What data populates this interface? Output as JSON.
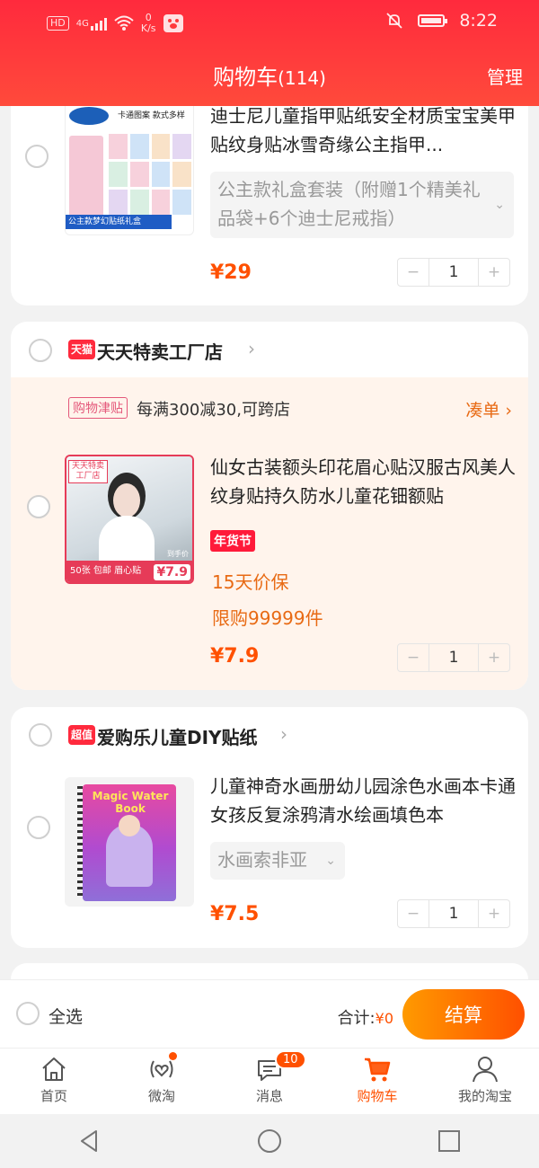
{
  "status_bar": {
    "hd_label": "HD",
    "network": "4G",
    "speed_value": "0",
    "speed_unit": "K/s",
    "time": "8:22"
  },
  "header": {
    "title": "购物车",
    "count": "(114)",
    "manage_label": "管理"
  },
  "items": [
    {
      "title": "迪士尼儿童指甲贴纸安全材质宝宝美甲贴纹身贴冰雪奇缘公主指甲...",
      "sku": "公主款礼盒套装（附赠1个精美礼品袋+6个迪士尼戒指）",
      "price": "¥29",
      "qty": "1",
      "image_caption": "公主款梦幻贴纸礼盒",
      "image_top_text": "卡通图案 款式多样"
    }
  ],
  "shop2": {
    "badge": "天猫",
    "name": "天天特卖工厂店",
    "promo_tag": "购物津贴",
    "promo_text": "每满300减30,可跨店",
    "promo_link": "凑单",
    "item": {
      "title": "仙女古装额头印花眉心贴汉服古风美人纹身贴持久防水儿童花钿额贴",
      "tag": "年货节",
      "guarantee": "15天价保",
      "limit": "限购99999件",
      "price": "¥7.9",
      "qty": "1",
      "image_store": "天天特卖工厂店",
      "image_caption": "50张 包邮 眉心贴",
      "image_price": "¥7.9",
      "image_price_label": "到手价"
    }
  },
  "shop3": {
    "badge": "超值",
    "name": "爱购乐儿童DIY贴纸",
    "item": {
      "title": "儿童神奇水画册幼儿园涂色水画本卡通女孩反复涂鸦清水绘画填色本",
      "sku": "水画索非亚",
      "price": "¥7.5",
      "qty": "1",
      "image_text": "Magic Water Book"
    }
  },
  "checkout": {
    "select_all": "全选",
    "total_label": "合计:",
    "total_value": "¥0",
    "pay_label": "结算"
  },
  "tabs": [
    {
      "label": "首页"
    },
    {
      "label": "微淘"
    },
    {
      "label": "消息",
      "badge": "10"
    },
    {
      "label": "购物车"
    },
    {
      "label": "我的淘宝"
    }
  ],
  "colors": {
    "header": "#ff2a3d",
    "accent": "#ff5000",
    "promo_bg": "#fff4ec"
  }
}
